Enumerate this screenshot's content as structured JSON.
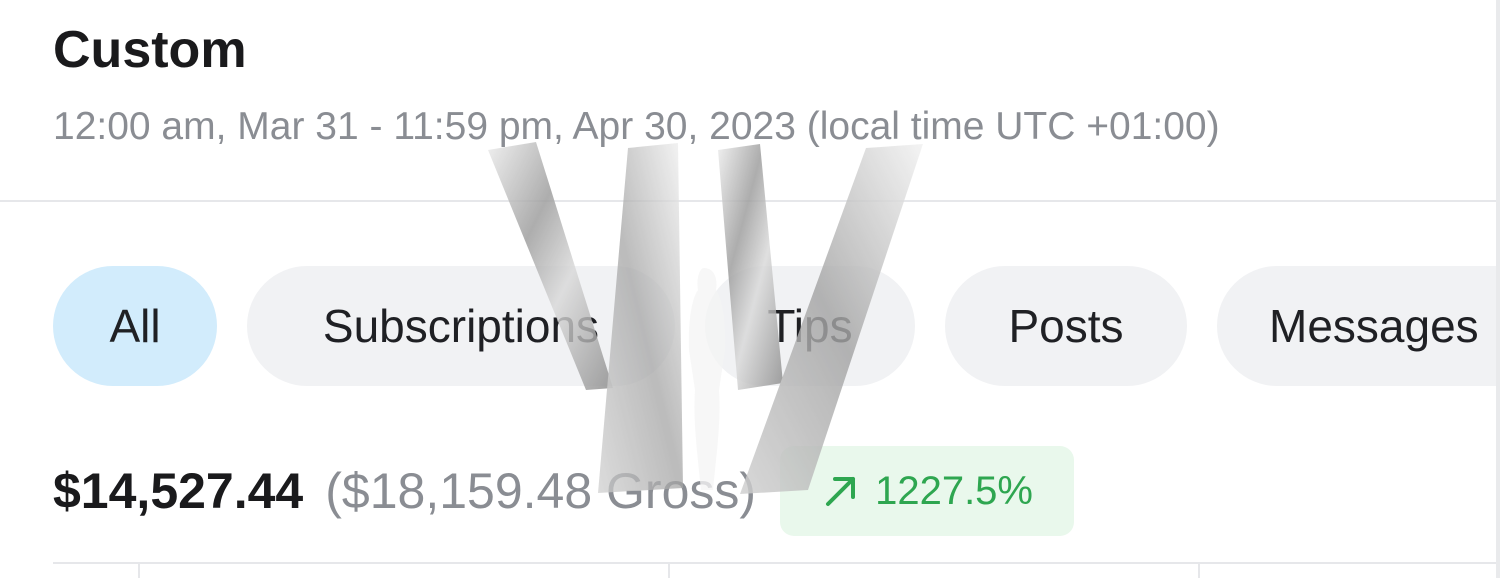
{
  "header": {
    "title": "Custom",
    "date_range": "12:00 am, Mar 31 - 11:59 pm, Apr 30, 2023 (local time UTC +01:00)"
  },
  "tabs": [
    {
      "label": "All",
      "active": true
    },
    {
      "label": "Subscriptions",
      "active": false
    },
    {
      "label": "Tips",
      "active": false
    },
    {
      "label": "Posts",
      "active": false
    },
    {
      "label": "Messages",
      "active": false
    }
  ],
  "summary": {
    "net": "$14,527.44",
    "gross": "($18,159.48 Gross)",
    "change": "1227.5%",
    "change_icon": "trend-up-arrow-icon",
    "change_color": "#2ea650"
  },
  "colors": {
    "active_tab": "#d2ecfc",
    "inactive_tab": "#f1f2f4",
    "badge_background": "#e9f8ec"
  },
  "watermark": {
    "icon": "w-logo-watermark"
  }
}
